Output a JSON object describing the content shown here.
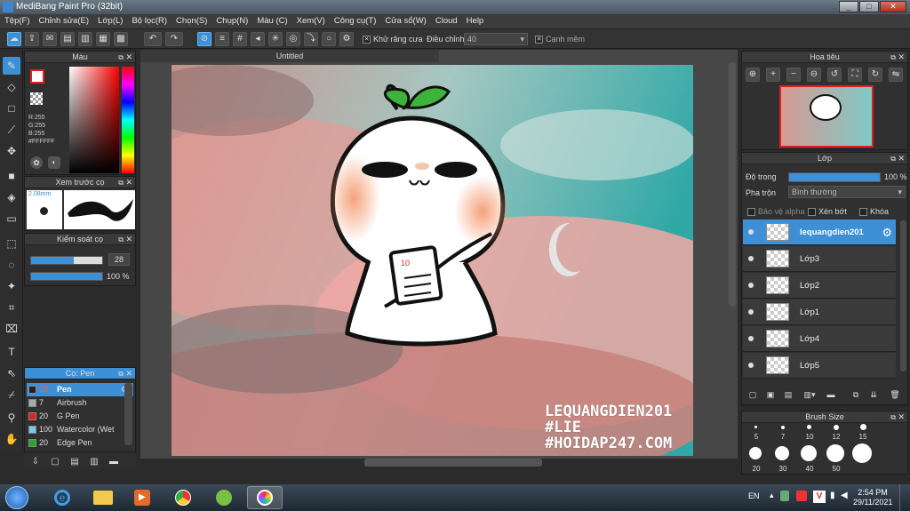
{
  "window": {
    "title": "MediBang Paint Pro (32bit)",
    "min": "_",
    "max": "□",
    "close": "✕"
  },
  "menu": [
    "Tệp(F)",
    "Chỉnh sửa(E)",
    "Lớp(L)",
    "Bộ lọc(R)",
    "Chọn(S)",
    "Chụp(N)",
    "Màu (C)",
    "Xem(V)",
    "Công cụ(T)",
    "Cửa sổ(W)",
    "Cloud",
    "Help"
  ],
  "toolbar": {
    "antialias": "Khử răng cưa",
    "adjust": "Điều chỉnh",
    "adjust_value": "40",
    "snap": "Cạnh mềm"
  },
  "color_panel": {
    "title": "Màu",
    "r": "R:255",
    "g": "G:255",
    "b": "B:255",
    "hex": "#FFFFFF"
  },
  "preview_panel": {
    "title": "Xem trước cọ",
    "size": "2.08mm"
  },
  "control_panel": {
    "title": "Kiểm soát cọ",
    "size_value": "28",
    "opacity_value": "100 %",
    "size_fraction": 0.6,
    "opacity_fraction": 1.0
  },
  "brush_panel": {
    "title": "Cọ: Pen",
    "items": [
      {
        "size": "28",
        "name": "Pen",
        "color": "#222222",
        "selected": true
      },
      {
        "size": "7",
        "name": "Airbrush",
        "color": "#aaaaaa",
        "selected": false
      },
      {
        "size": "20",
        "name": "G Pen",
        "color": "#e02020",
        "selected": false
      },
      {
        "size": "100",
        "name": "Watercolor (Wet",
        "color": "#7cc8f0",
        "selected": false
      },
      {
        "size": "20",
        "name": "Edge Pen",
        "color": "#22aa22",
        "selected": false
      }
    ]
  },
  "canvas": {
    "tab_title": "Untitled",
    "watermark": [
      "LEQUANGDIEN201",
      "#LIE",
      "#HOIDAP247.COM"
    ],
    "page_number": "10"
  },
  "navigator": {
    "title": "Hoa tiêu"
  },
  "layer_panel": {
    "title": "Lớp",
    "opacity_label": "Độ trong",
    "opacity_value": "100 %",
    "opacity_fraction": 1.0,
    "blend_label": "Pha trộn",
    "blend_value": "Bình thường",
    "protect_alpha": "Bảo vệ alpha",
    "clip": "Xén bớt",
    "lock": "Khóa",
    "layers": [
      {
        "name": "lequangdien201",
        "selected": true
      },
      {
        "name": "Lớp3",
        "selected": false
      },
      {
        "name": "Lớp2",
        "selected": false
      },
      {
        "name": "Lớp1",
        "selected": false
      },
      {
        "name": "Lớp4",
        "selected": false
      },
      {
        "name": "Lớp5",
        "selected": false
      }
    ]
  },
  "brush_size_panel": {
    "title": "Brush Size",
    "sizes_row1": [
      "5",
      "7",
      "10",
      "12",
      "15"
    ],
    "sizes_row2": [
      "20",
      "30",
      "40",
      "50"
    ]
  },
  "taskbar": {
    "lang": "EN",
    "time": "2:54 PM",
    "date": "29/11/2021"
  },
  "colors": {
    "accent": "#3d8fd6",
    "panel": "#303030"
  }
}
